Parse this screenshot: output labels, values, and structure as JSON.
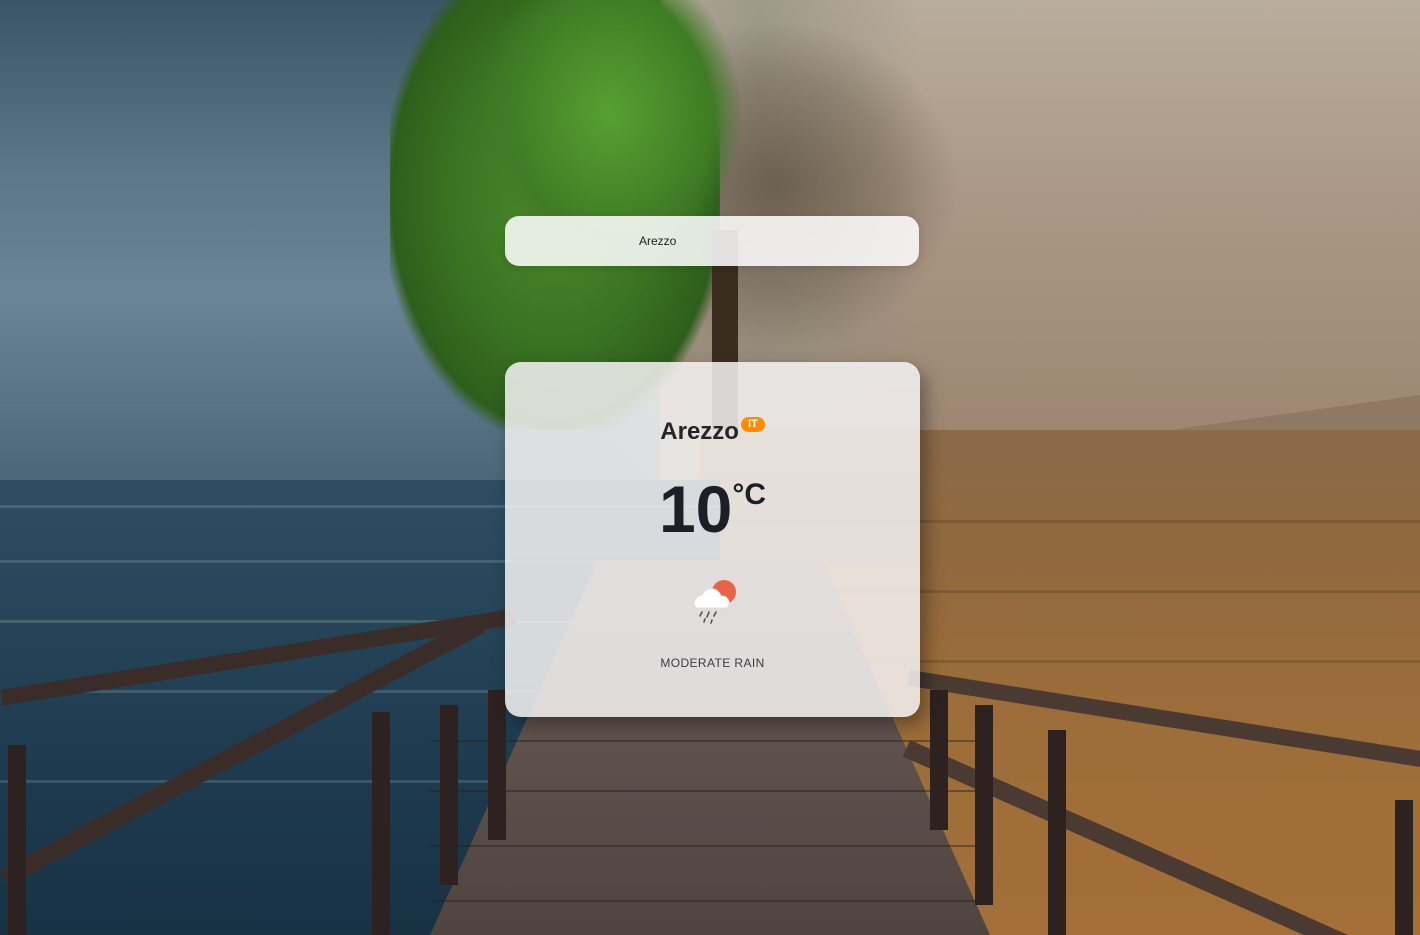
{
  "search": {
    "value": "Arezzo"
  },
  "weather": {
    "city": "Arezzo",
    "country": "IT",
    "temperature": "10",
    "unit": "°C",
    "condition": "MODERATE RAIN",
    "icon": "cloud-rain-sun-icon"
  },
  "colors": {
    "badge": "#ff8c00",
    "sun": "#e8634a"
  }
}
